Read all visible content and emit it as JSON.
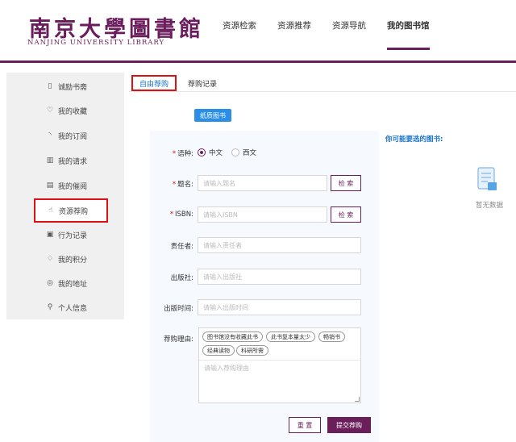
{
  "header": {
    "logo_cn": "南京大學圖書館",
    "logo_en": "NANJING UNIVERSITY LIBRARY",
    "nav": [
      {
        "label": "资源检索"
      },
      {
        "label": "资源推荐"
      },
      {
        "label": "资源导航"
      },
      {
        "label": "我的图书馆",
        "active": true
      }
    ]
  },
  "sidebar": {
    "items": [
      {
        "label": "诚励书斋",
        "icon": "book-icon"
      },
      {
        "label": "我的收藏",
        "icon": "heart-icon"
      },
      {
        "label": "我的订阅",
        "icon": "rss-icon"
      },
      {
        "label": "我的请求",
        "icon": "request-icon"
      },
      {
        "label": "我的催阅",
        "icon": "remind-icon"
      },
      {
        "label": "资源荐购",
        "icon": "thumbs-up-icon",
        "active": true
      },
      {
        "label": "行为记录",
        "icon": "record-icon"
      },
      {
        "label": "我的积分",
        "icon": "points-icon"
      },
      {
        "label": "我的地址",
        "icon": "location-icon"
      },
      {
        "label": "个人信息",
        "icon": "user-icon"
      }
    ]
  },
  "tabs": [
    {
      "label": "自由荐购",
      "active": true
    },
    {
      "label": "荐购记录"
    }
  ],
  "paper_button": "纸质图书",
  "form": {
    "language": {
      "label": "语种:",
      "options": [
        "中文",
        "西文"
      ],
      "selected": "中文"
    },
    "title": {
      "label": "题名:",
      "placeholder": "请输入题名",
      "search_label": "检 索"
    },
    "isbn": {
      "label": "ISBN:",
      "placeholder": "请输入ISBN",
      "search_label": "检 索"
    },
    "author": {
      "label": "责任者:",
      "placeholder": "请输入责任者"
    },
    "publisher": {
      "label": "出版社:",
      "placeholder": "请输入出版社"
    },
    "pub_date": {
      "label": "出版时间:",
      "placeholder": "请输入出版时间"
    },
    "reason": {
      "label": "荐购理由:",
      "chips": [
        "图书馆没有收藏此书",
        "此书复本量太少",
        "畅销书",
        "经典读物",
        "科研所需"
      ],
      "placeholder": "请输入荐购理由"
    },
    "reset_label": "重 置",
    "submit_label": "提交荐购"
  },
  "suggestions": {
    "title": "你可能要选的图书:",
    "empty_text": "暂无数据"
  },
  "colors": {
    "brand": "#6a1f5a",
    "accent_blue": "#2a8ee8",
    "highlight_red": "#dd1111"
  }
}
